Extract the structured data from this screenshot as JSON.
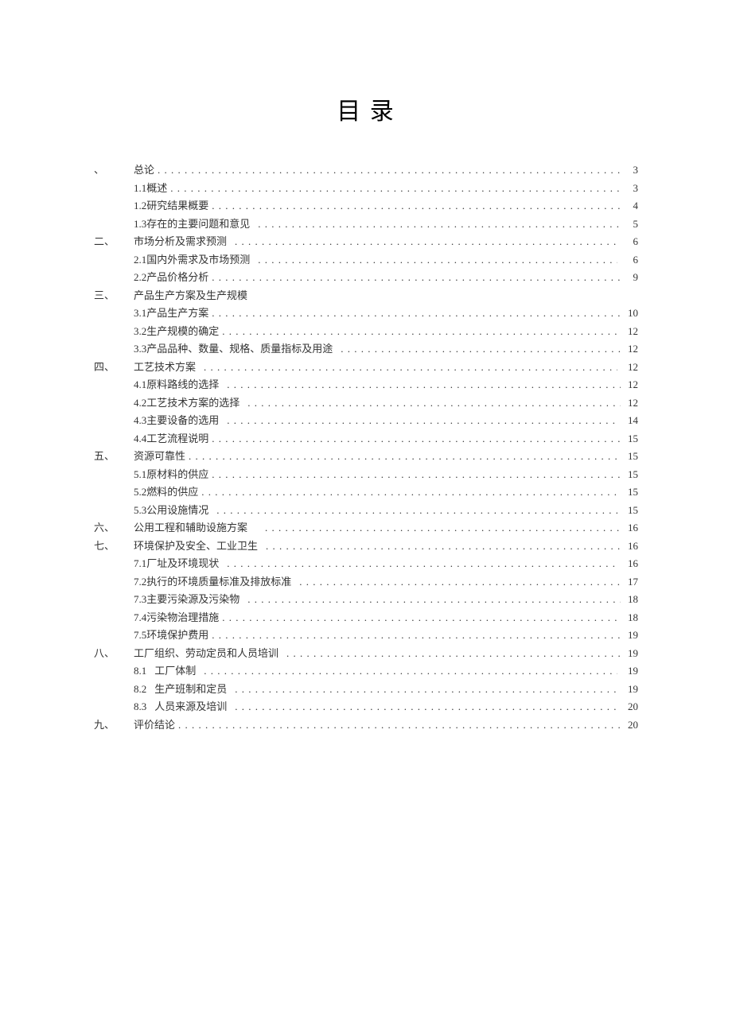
{
  "title": "目 录",
  "entries": [
    {
      "type": "chapter",
      "num": "、",
      "label": "总论",
      "page": "3"
    },
    {
      "type": "sub",
      "label": "1.1概述",
      "page": "3"
    },
    {
      "type": "sub",
      "label": "1.2研究结果概要",
      "page": "4"
    },
    {
      "type": "sub",
      "label": "1.3存在的主要问题和意见",
      "page": "5",
      "gap": true
    },
    {
      "type": "chapter",
      "num": "二、",
      "label": "市场分析及需求预测",
      "page": "6",
      "gap": true
    },
    {
      "type": "sub",
      "label": "2.1国内外需求及市场预测",
      "page": "6",
      "gap": true,
      "wide": true
    },
    {
      "type": "sub",
      "label": "2.2产品价格分析",
      "page": "9"
    },
    {
      "type": "chapter",
      "num": "三、",
      "label": "产品生产方案及生产规模",
      "page": "",
      "noleader": true
    },
    {
      "type": "sub",
      "label": "3.1产品生产方案",
      "page": "10"
    },
    {
      "type": "sub",
      "label": "3.2生产规模的确定",
      "page": "12"
    },
    {
      "type": "sub",
      "label": "3.3产品品种、数量、规格、质量指标及用途",
      "page": "12",
      "gap": true
    },
    {
      "type": "chapter",
      "num": "四、",
      "label": "工艺技术方案",
      "page": "12",
      "gap": true,
      "wide": true
    },
    {
      "type": "sub",
      "label": "4.1原料路线的选择",
      "page": "12",
      "gap": true
    },
    {
      "type": "sub",
      "label": "4.2工艺技术方案的选择",
      "page": "12",
      "gap": true
    },
    {
      "type": "sub",
      "label": "4.3主要设备的选用",
      "page": "14",
      "gap": true,
      "wide": true
    },
    {
      "type": "sub",
      "label": "4.4工艺流程说明",
      "page": "15"
    },
    {
      "type": "chapter",
      "num": "五、",
      "label": "资源可靠性",
      "page": "15"
    },
    {
      "type": "sub",
      "label": "5.1原材料的供应",
      "page": "15"
    },
    {
      "type": "sub",
      "label": "5.2燃料的供应",
      "page": "15"
    },
    {
      "type": "sub",
      "label": "5.3公用设施情况",
      "page": "15",
      "gap": true,
      "wide": true
    },
    {
      "type": "chapter",
      "num": "六、",
      "label": "公用工程和辅助设施方案",
      "page": "16",
      "gap": true,
      "biggap": true
    },
    {
      "type": "chapter",
      "num": "七、",
      "label": "环境保护及安全、工业卫生",
      "page": "16",
      "gap": true
    },
    {
      "type": "sub",
      "label": "7.1厂址及环境现状",
      "page": "16",
      "gap": true,
      "wide": true
    },
    {
      "type": "sub",
      "label": "7.2执行的环境质量标准及排放标准",
      "page": "17",
      "gap": true
    },
    {
      "type": "sub",
      "label": "7.3主要污染源及污染物",
      "page": "18",
      "gap": true
    },
    {
      "type": "sub",
      "label": "7.4污染物治理措施",
      "page": "18"
    },
    {
      "type": "sub",
      "label": "7.5环境保护费用",
      "page": "19"
    },
    {
      "type": "chapter",
      "num": "八、",
      "label": "工厂组织、劳动定员和人员培训",
      "page": "19",
      "gap": true
    },
    {
      "type": "sub2",
      "prefix": "8.1",
      "label": "工厂体制",
      "page": "19",
      "gap": true,
      "wide": true
    },
    {
      "type": "sub2",
      "prefix": "8.2",
      "label": "生产班制和定员",
      "page": "19",
      "gap": true
    },
    {
      "type": "sub2",
      "prefix": "8.3",
      "label": "人员来源及培训",
      "page": "20",
      "gap": true
    },
    {
      "type": "chapter",
      "num": "九、",
      "label": "评价结论",
      "page": "20"
    }
  ]
}
